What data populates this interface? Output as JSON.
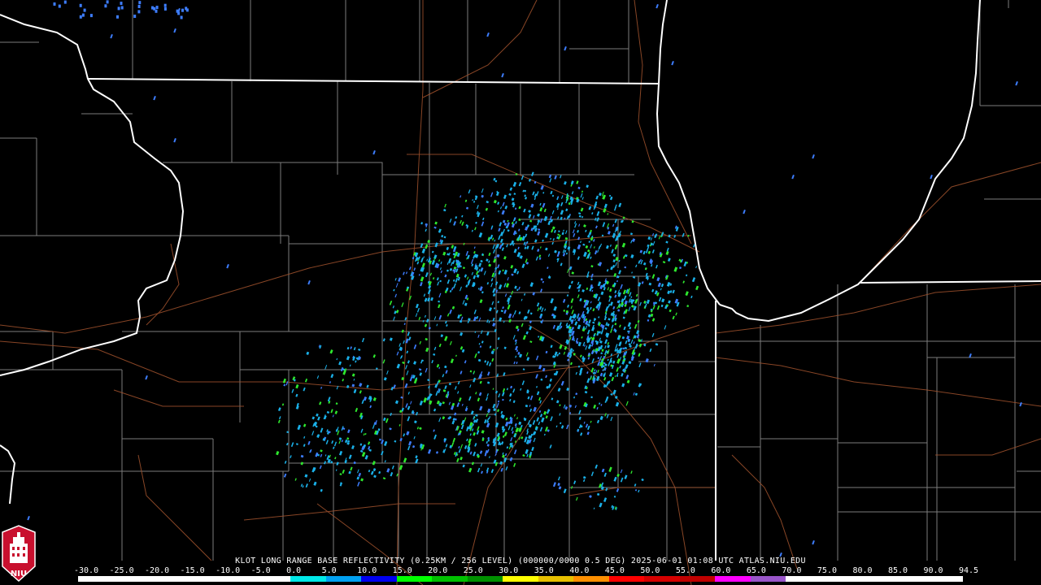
{
  "caption": {
    "product": "KLOT LONG RANGE BASE REFLECTIVITY",
    "resolution": "(0.25KM / 256 LEVEL)",
    "volume": "(000000/0000 0.5 DEG)",
    "timestamp": "2025-06-01 01:08 UTC",
    "source": "ATLAS.NIU.EDU"
  },
  "scale": {
    "labels": [
      "-30.0",
      "-25.0",
      "-20.0",
      "-15.0",
      "-10.0",
      "-5.0",
      "0.0",
      "5.0",
      "10.0",
      "15.0",
      "20.0",
      "25.0",
      "30.0",
      "35.0",
      "40.0",
      "45.0",
      "50.0",
      "55.0",
      "60.0",
      "65.0",
      "70.0",
      "75.0",
      "80.0",
      "85.0",
      "90.0",
      "94.5"
    ],
    "colors": [
      "#ffffff",
      "#ffffff",
      "#ffffff",
      "#ffffff",
      "#ffffff",
      "#ffffff",
      "#00e8e8",
      "#00a0f0",
      "#0000f0",
      "#00ff00",
      "#00c000",
      "#009000",
      "#ffff00",
      "#e8c000",
      "#ff9000",
      "#ff0000",
      "#d60000",
      "#c00000",
      "#ff00ff",
      "#9955c9",
      "#ffffff",
      "#ffffff",
      "#ffffff",
      "#ffffff",
      "#ffffff"
    ]
  },
  "logo": {
    "text": "NIU",
    "color": "#c8102e"
  },
  "map_colors": {
    "background": "#000000",
    "state_border": "#ffffff",
    "county_border": "#8a8a8a",
    "road": "#a0522d",
    "echo_light": "#1ab0e8",
    "echo_medium": "#3d7dff",
    "echo_strong": "#2ee82e"
  }
}
